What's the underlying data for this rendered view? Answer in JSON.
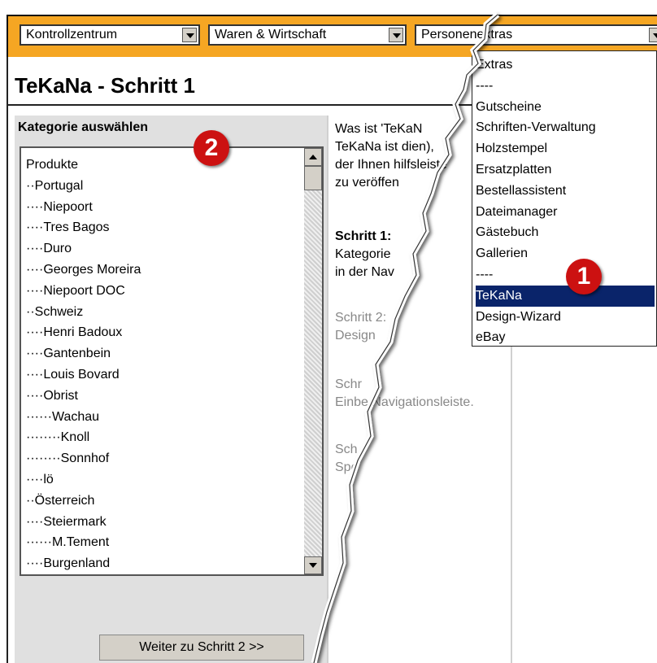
{
  "topnav": {
    "select1": "Kontrollzentrum",
    "select2": "Waren & Wirtschaft",
    "select3": "Personenextras"
  },
  "page": {
    "title": "TeKaNa - Schritt 1"
  },
  "category": {
    "header": "Kategorie auswählen",
    "items": [
      "Produkte",
      "··Portugal",
      "····Niepoort",
      "····Tres Bagos",
      "····Duro",
      "····Georges Moreira",
      "····Niepoort DOC",
      "··Schweiz",
      "····Henri Badoux",
      "····Gantenbein",
      "····Louis Bovard",
      "····Obrist",
      "······Wachau",
      "········Knoll",
      "········Sonnhof",
      "····lö",
      "··Österreich",
      "····Steiermark",
      "······M.Tement",
      "····Burgenland"
    ],
    "next_button": "Weiter zu Schritt 2 >>"
  },
  "info": {
    "line1": "Was ist 'TeKaN",
    "line2": "TeKaNa ist dien),",
    "line3": "der Ihnen hilfsleiste",
    "line4": "zu veröffen",
    "step1_heading": "Schritt 1:",
    "step1_line1": "Kategorie",
    "step1_line2": "in der Nav",
    "step2_line1": "Schritt 2:",
    "step2_line2": "Design",
    "step3_line1": "Schr",
    "step3_line2": "Einbe Navigationsleiste.",
    "step4_line1": "Sch",
    "step4_line2": "Spe"
  },
  "dropdown": {
    "items": [
      "Extras",
      "----",
      "Gutscheine",
      "Schriften-Verwaltung",
      "Holzstempel",
      "Ersatzplatten",
      "Bestellassistent",
      "Dateimanager",
      "Gästebuch",
      "Gallerien",
      "----",
      "TeKaNa",
      "Design-Wizard",
      "eBay"
    ],
    "selected": "TeKaNa"
  },
  "annotations": {
    "badge1": "1",
    "badge2": "2"
  },
  "colors": {
    "nav_strip": "#f5a623",
    "selection": "#0a246a",
    "badge": "#cc1111",
    "panel": "#e0e0e0"
  }
}
